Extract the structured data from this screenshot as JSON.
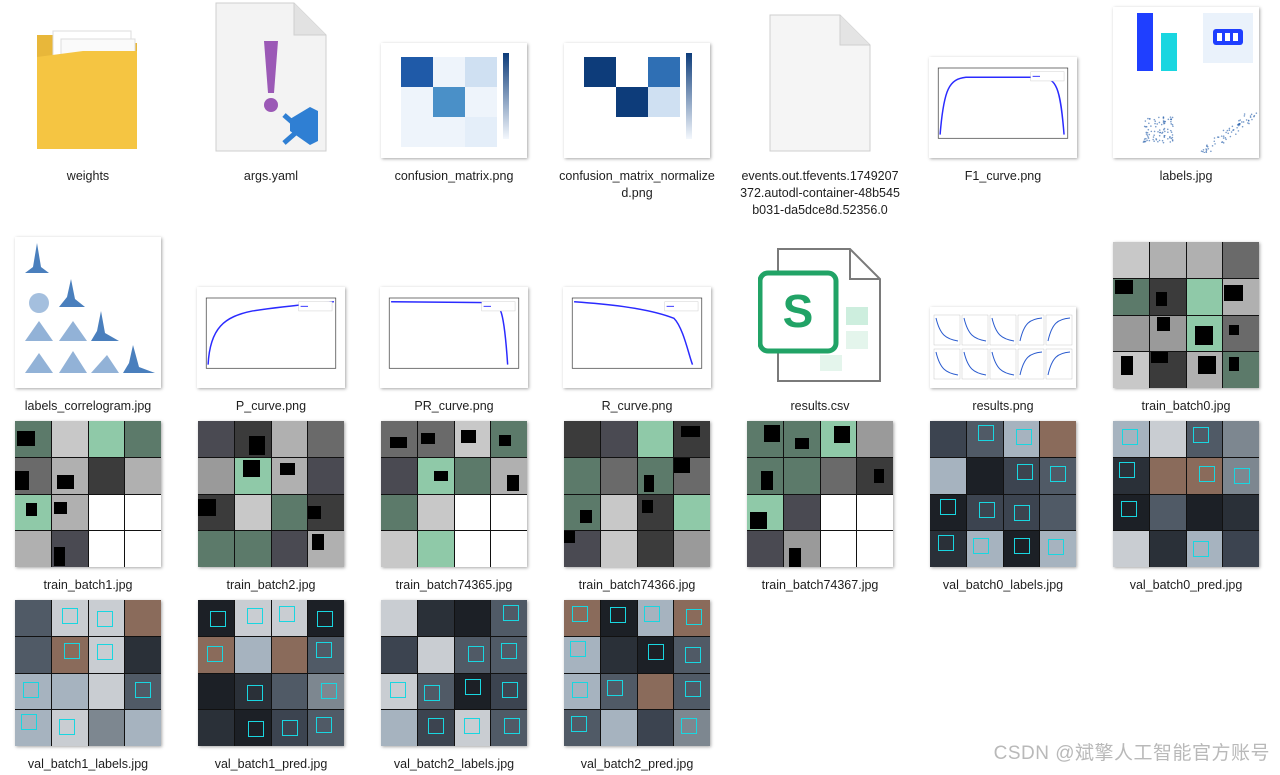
{
  "files": [
    {
      "name": "weights",
      "kind": "folder"
    },
    {
      "name": "args.yaml",
      "kind": "yaml"
    },
    {
      "name": "confusion_matrix.png",
      "kind": "confusion"
    },
    {
      "name": "confusion_matrix_normalized.png",
      "kind": "confusion-norm"
    },
    {
      "name": "events.out.tfevents.1749207372.autodl-container-48b545b031-da5dce8d.52356.0",
      "kind": "blank"
    },
    {
      "name": "F1_curve.png",
      "kind": "curve-f1"
    },
    {
      "name": "labels.jpg",
      "kind": "labels"
    },
    {
      "name": "labels_correlogram.jpg",
      "kind": "correlogram"
    },
    {
      "name": "P_curve.png",
      "kind": "curve-p"
    },
    {
      "name": "PR_curve.png",
      "kind": "curve-pr"
    },
    {
      "name": "R_curve.png",
      "kind": "curve-r"
    },
    {
      "name": "results.csv",
      "kind": "csv"
    },
    {
      "name": "results.png",
      "kind": "results"
    },
    {
      "name": "train_batch0.jpg",
      "kind": "batch"
    },
    {
      "name": "train_batch1.jpg",
      "kind": "batch"
    },
    {
      "name": "train_batch2.jpg",
      "kind": "batch"
    },
    {
      "name": "train_batch74365.jpg",
      "kind": "batch"
    },
    {
      "name": "train_batch74366.jpg",
      "kind": "batch"
    },
    {
      "name": "train_batch74367.jpg",
      "kind": "batch"
    },
    {
      "name": "val_batch0_labels.jpg",
      "kind": "val"
    },
    {
      "name": "val_batch0_pred.jpg",
      "kind": "val"
    },
    {
      "name": "val_batch1_labels.jpg",
      "kind": "val"
    },
    {
      "name": "val_batch1_pred.jpg",
      "kind": "val"
    },
    {
      "name": "val_batch2_labels.jpg",
      "kind": "val"
    },
    {
      "name": "val_batch2_pred.jpg",
      "kind": "val"
    }
  ],
  "watermark": "CSDN @斌擎人工智能官方账号",
  "colors": {
    "folder": "#f5c542",
    "vscode": "#2f7fd3",
    "yaml_mark": "#9b59b6",
    "sheet": "#21a366",
    "chart_blue": "#1f3fff"
  }
}
